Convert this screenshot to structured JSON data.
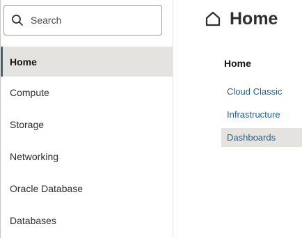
{
  "search": {
    "placeholder": "Search",
    "icon": "search-icon"
  },
  "nav": {
    "items": [
      {
        "label": "Home",
        "active": true
      },
      {
        "label": "Compute",
        "active": false
      },
      {
        "label": "Storage",
        "active": false
      },
      {
        "label": "Networking",
        "active": false
      },
      {
        "label": "Oracle Database",
        "active": false
      },
      {
        "label": "Databases",
        "active": false
      }
    ]
  },
  "header": {
    "icon": "home-icon",
    "title": "Home"
  },
  "subnav": {
    "heading": "Home",
    "items": [
      {
        "label": "Cloud Classic",
        "selected": false
      },
      {
        "label": "Infrastructure",
        "selected": false
      },
      {
        "label": "Dashboards",
        "selected": true
      }
    ]
  },
  "colors": {
    "accent": "#35667f",
    "link": "#1f5f8b",
    "active_bg": "#e5e3e0",
    "text": "#312d2a"
  }
}
